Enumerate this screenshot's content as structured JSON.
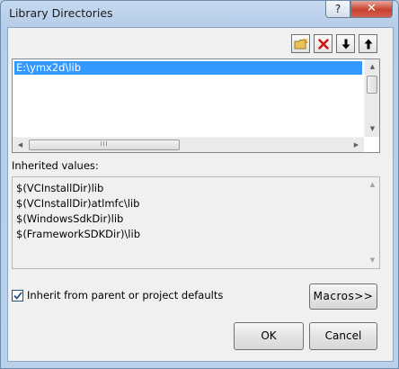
{
  "window": {
    "title": "Library Directories",
    "help_label": "?",
    "close_label": "✕"
  },
  "toolbar": {
    "new_line_icon": "folder-new-icon",
    "delete_icon": "delete-x-icon",
    "down_icon": "arrow-down-icon",
    "up_icon": "arrow-up-icon"
  },
  "directories": {
    "items": [
      "E:\\ymx2d\\lib"
    ]
  },
  "inherited": {
    "label": "Inherited values:",
    "items": [
      "$(VCInstallDir)lib",
      "$(VCInstallDir)atlmfc\\lib",
      "$(WindowsSdkDir)lib",
      "$(FrameworkSDKDir)\\lib"
    ]
  },
  "options": {
    "inherit_label": "Inherit from parent or project defaults",
    "inherit_checked": true
  },
  "buttons": {
    "macros": "Macros>>",
    "ok": "OK",
    "cancel": "Cancel"
  },
  "colors": {
    "selection": "#3399ff",
    "dialog_bg": "#f0f0f0",
    "close_red": "#c8412e"
  }
}
